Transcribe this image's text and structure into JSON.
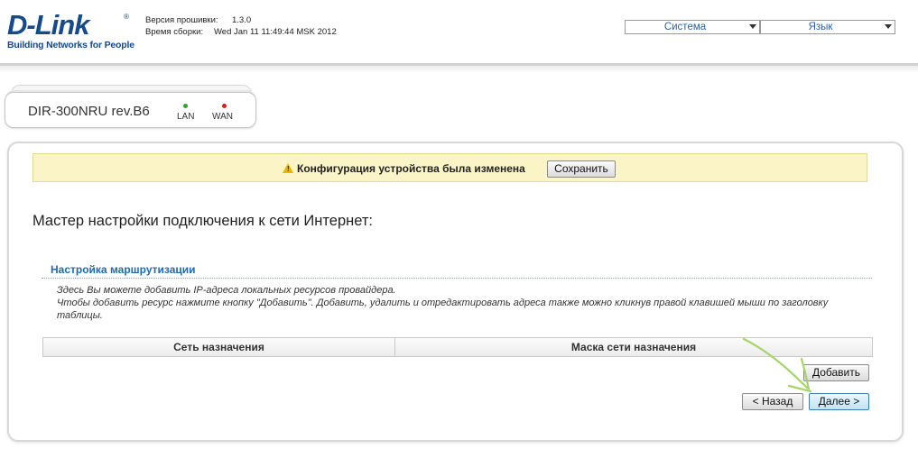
{
  "brand": {
    "logo_text": "D-Link",
    "tagline": "Building Networks for People",
    "reg_mark": "®"
  },
  "firmware": {
    "version_label": "Версия прошивки:",
    "version_value": "1.3.0",
    "build_label": "Время сборки:",
    "build_value": "Wed Jan 11 11:49:44 MSK 2012"
  },
  "top_menus": {
    "system": "Система",
    "language": "Язык"
  },
  "device": {
    "name": "DIR-300NRU rev.B6",
    "indicators": [
      {
        "label": "LAN",
        "color": "#2aa82a"
      },
      {
        "label": "WAN",
        "color": "#d62020"
      }
    ]
  },
  "notice": {
    "icon": "warning-icon",
    "text": "Конфигурация устройства была изменена",
    "save_button": "Сохранить"
  },
  "wizard": {
    "title": "Мастер настройки подключения к сети Интернет:",
    "section_title": "Настройка маршрутизации",
    "description_line1": "Здесь Вы можете добавить IP-адреса локальных ресурсов провайдера.",
    "description_line2": "Чтобы добавить ресурс нажмите кнопку \"Добавить\". Добавить, удалить и отредактировать адреса также можно кликнув правой клавишей мыши по заголовку таблицы."
  },
  "table": {
    "columns": [
      "Сеть назначения",
      "Маска сети назначения"
    ],
    "rows": []
  },
  "buttons": {
    "add": "Добавить",
    "back": "< Назад",
    "next": "Далее >"
  },
  "colors": {
    "brand_blue": "#164a8a",
    "link_blue": "#1e6ab0",
    "notice_bg": "#fbf4c6",
    "annotation_arrow": "#a6d36a"
  }
}
